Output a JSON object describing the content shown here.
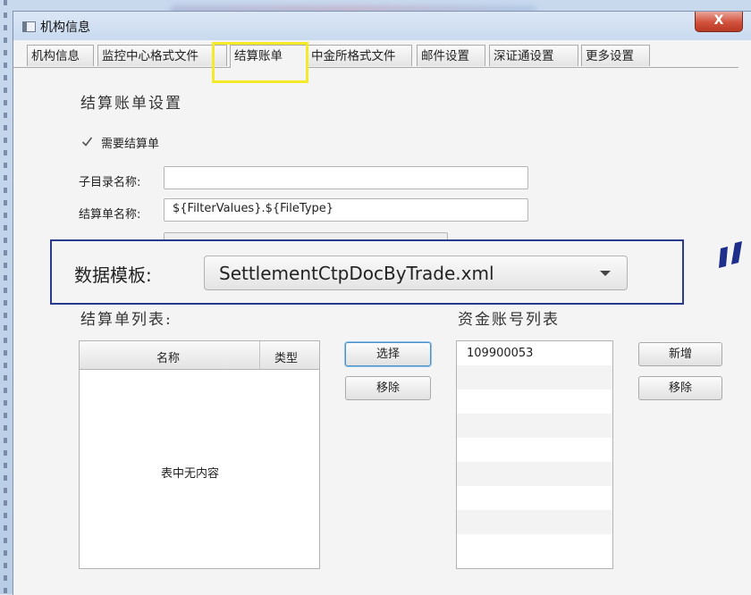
{
  "window": {
    "title": "机构信息",
    "close_label": "X"
  },
  "tabs": [
    {
      "label": "机构信息"
    },
    {
      "label": "监控中心格式文件"
    },
    {
      "label": "结算账单"
    },
    {
      "label": "中金所格式文件"
    },
    {
      "label": "邮件设置"
    },
    {
      "label": "深证通设置"
    },
    {
      "label": "更多设置"
    }
  ],
  "settings": {
    "heading": "结算账单设置",
    "need_settlement_label": "需要结算单",
    "need_settlement_checked": true,
    "subdir_label": "子目录名称:",
    "subdir_value": "",
    "filename_label": "结算单名称:",
    "filename_value": "${FilterValues}.${FileType}"
  },
  "template": {
    "label": "数据模板:",
    "selected": "SettlementCtpDocByTrade.xml"
  },
  "settlement_list": {
    "heading": "结算单列表:",
    "columns": [
      "名称",
      "类型"
    ],
    "empty_text": "表中无内容",
    "select_button": "选择",
    "remove_button": "移除"
  },
  "account_list": {
    "heading": "资金账号列表",
    "items": [
      "109900053",
      "",
      "",
      "",
      "",
      "",
      "",
      "",
      ""
    ],
    "add_button": "新增",
    "remove_button": "移除"
  },
  "colors": {
    "highlight": "#f4ea2a",
    "zoom_border": "#2a3a8c"
  }
}
